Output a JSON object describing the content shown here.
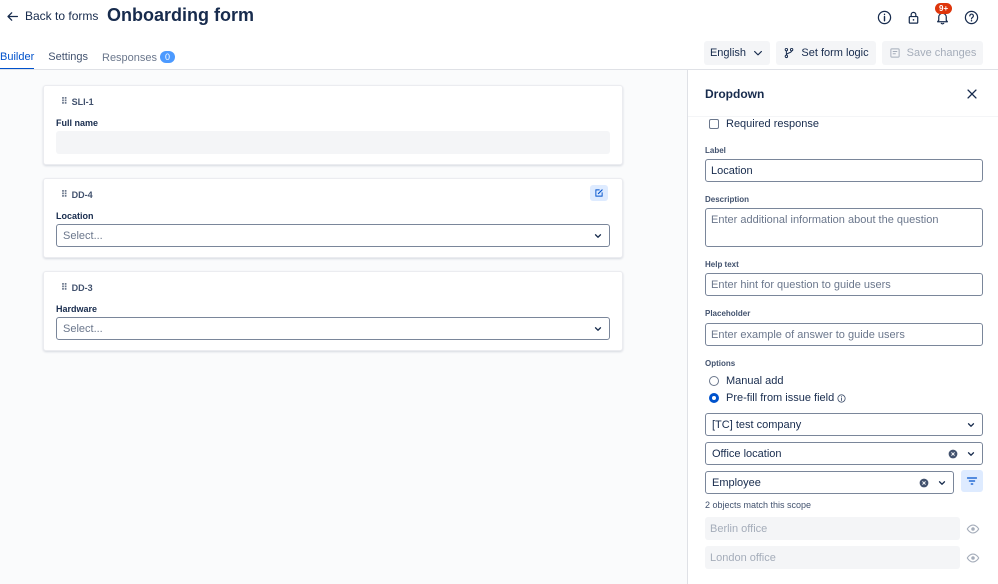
{
  "header": {
    "back_label": "Back to forms",
    "title": "Onboarding form",
    "notif_badge": "9+"
  },
  "tabs": [
    {
      "label": "Builder",
      "active": true
    },
    {
      "label": "Settings"
    },
    {
      "label": "Responses",
      "count": "0"
    }
  ],
  "toolbar": {
    "language": "English",
    "logic_label": "Set form logic",
    "save_label": "Save changes"
  },
  "cards": [
    {
      "id": "SLI-1",
      "label": "Full name",
      "type": "text"
    },
    {
      "id": "DD-4",
      "label": "Location",
      "type": "select",
      "placeholder": "Select..."
    },
    {
      "id": "DD-3",
      "label": "Hardware",
      "type": "select",
      "placeholder": "Select..."
    }
  ],
  "panel": {
    "title": "Dropdown",
    "required_label": "Required response",
    "label_label": "Label",
    "label_value": "Location",
    "description_label": "Description",
    "description_placeholder": "Enter additional information about the question",
    "help_label": "Help text",
    "help_placeholder": "Enter hint for question to guide users",
    "placeholder_label": "Placeholder",
    "placeholder_placeholder": "Enter example of answer to guide users",
    "options_label": "Options",
    "option_manual": "Manual add",
    "option_prefill": "Pre-fill from issue field",
    "selected_option": "prefill",
    "field_select": "[TC] test company",
    "object_type": "Office location",
    "attribute": "Employee",
    "match_note": "2 objects match this scope",
    "objects": [
      "Berlin office",
      "London office"
    ]
  },
  "colors": {
    "accent": "#0052cc",
    "badge": "#de350b",
    "count_badge": "#4c9aff"
  }
}
